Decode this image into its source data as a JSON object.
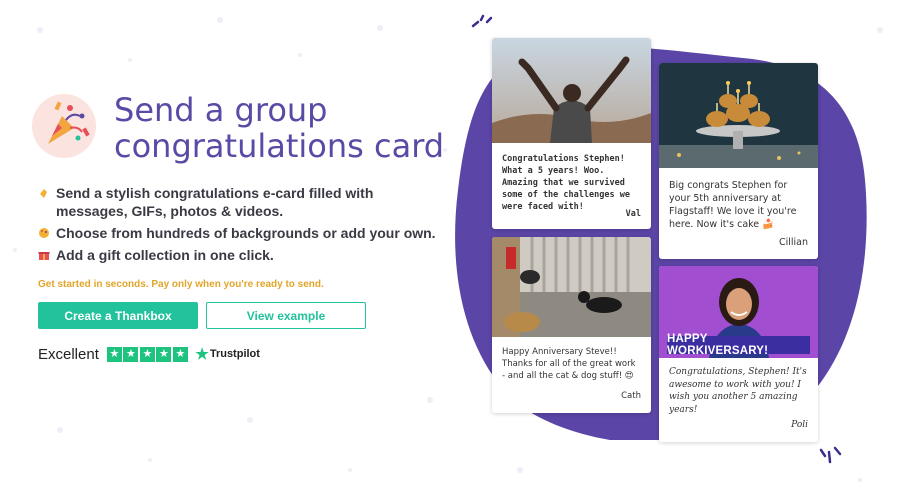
{
  "hero": {
    "title": "Send a group congratulations card",
    "icon": "party-popper-icon"
  },
  "features": [
    {
      "icon": "clapping-hands-icon",
      "text": "Send a stylish congratulations e-card filled with messages, GIFs, photos & videos."
    },
    {
      "icon": "palette-icon",
      "text": "Choose from hundreds of backgrounds or add your own."
    },
    {
      "icon": "gift-icon",
      "text": "Add a gift collection in one click."
    }
  ],
  "tagline": "Get started in seconds. Pay only when you're ready to send.",
  "buttons": {
    "primary": "Create a Thankbox",
    "secondary": "View example"
  },
  "rating": {
    "label": "Excellent",
    "stars": 5,
    "provider": "Trustpilot"
  },
  "cards": {
    "val": {
      "message": "Congratulations Stephen! What a 5 years! Woo. Amazing that we survived some of the challenges we were faced with!",
      "signature": "Val"
    },
    "cillian": {
      "message": "Big congrats Stephen for your 5th anniversary at Flagstaff! We love it you're here. Now it's cake 🍰",
      "signature": "Cillian"
    },
    "cath": {
      "message": "Happy Anniversary Steve!! Thanks for all of the great work - and all the cat & dog stuff! 😍",
      "signature": "Cath"
    },
    "poli": {
      "banner": "HAPPY WORKIVERSARY!",
      "message": "Congratulations, Stephen! It's awesome to work with you! I wish you another 5 amazing years!",
      "signature": "Poli"
    }
  },
  "colors": {
    "title": "#5a4aa6",
    "accent": "#22c29c",
    "tagline": "#e0a62a",
    "blob": "#5b45a6",
    "trustpilot": "#1ec37f"
  }
}
